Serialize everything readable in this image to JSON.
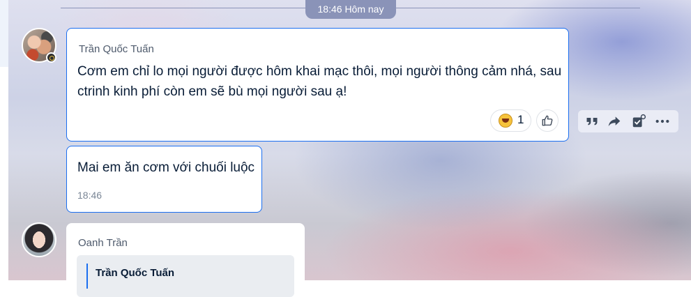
{
  "date_divider": {
    "label": "18:46 Hôm nay"
  },
  "messages": [
    {
      "sender": "Trần Quốc Tuấn",
      "text_line1": "Cơm em chỉ lo mọi người được hôm khai mạc thôi, mọi người thông cảm nhá, sau",
      "text_line2": "ctrinh kinh phí còn em sẽ bù mọi người sau ạ!",
      "reaction": {
        "emoji": "laughing-face-icon",
        "count": "1"
      }
    },
    {
      "text": "Mai em ăn cơm với chuối luộc",
      "time": "18:46"
    },
    {
      "sender": "Oanh Trần",
      "quote_sender": "Trần Quốc Tuấn"
    }
  ],
  "message_actions": [
    "quote-icon",
    "forward-icon",
    "add-task-icon",
    "more-icon"
  ],
  "colors": {
    "accent": "#1a6ef0",
    "divider": "#8a93b8",
    "text": "#081c36"
  }
}
